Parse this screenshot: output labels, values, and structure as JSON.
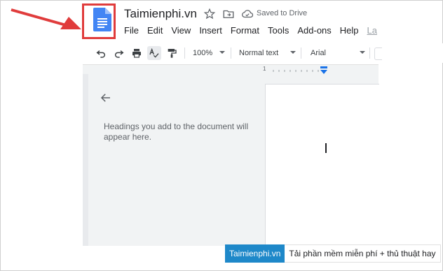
{
  "header": {
    "doc_title": "Taimienphi.vn",
    "saved_status": "Saved to Drive",
    "logo_icon": "google-docs-icon",
    "star_icon": "star-icon",
    "move_icon": "move-to-folder-icon",
    "cloud_icon": "cloud-check-icon"
  },
  "menu": {
    "items": [
      "File",
      "Edit",
      "View",
      "Insert",
      "Format",
      "Tools",
      "Add-ons",
      "Help",
      "La"
    ]
  },
  "toolbar": {
    "zoom": "100%",
    "style": "Normal text",
    "font": "Arial",
    "icons": [
      "undo-icon",
      "redo-icon",
      "print-icon",
      "spellcheck-icon",
      "paint-format-icon"
    ]
  },
  "ruler": {
    "number": "1"
  },
  "outline": {
    "hint": "Headings you add to the document will appear here."
  },
  "watermark": {
    "brand": "Taimienphi.vn",
    "tagline": "Tải phần mềm miễn phí + thủ thuật hay"
  },
  "colors": {
    "annotation_red": "#e03c3c",
    "docs_blue": "#4285f4",
    "watermark_blue": "#1e88c9"
  }
}
